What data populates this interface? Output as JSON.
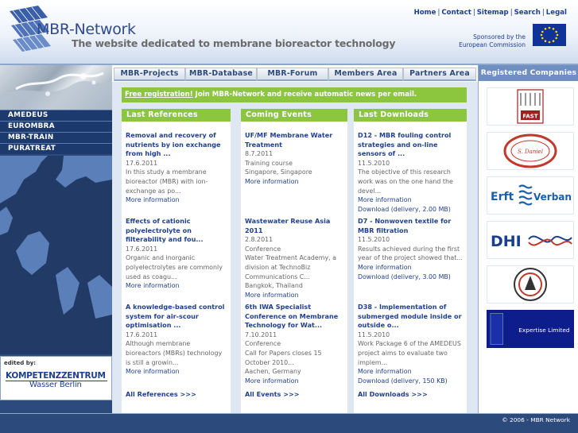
{
  "header": {
    "site_name": "MBR-Network",
    "tagline": "The website dedicated to membrane bioreactor technology",
    "top_links": [
      "Home",
      "Contact",
      "Sitemap",
      "Search",
      "Legal"
    ],
    "sponsor_line1": "Sponsored by the",
    "sponsor_line2": "European Commission"
  },
  "sidebar": {
    "projects": [
      "AMEDEUS",
      "EUROMBRA",
      "MBR-TRAIN",
      "PURATREAT"
    ],
    "edited_by": "edited by:",
    "editor_logo_line1": "KOMPETENZZENTRUM",
    "editor_logo_line2": "Wasser Berlin"
  },
  "tabs": [
    "MBR-Projects",
    "MBR-Database",
    "MBR-Forum",
    "Members Area",
    "Partners Area"
  ],
  "registration": {
    "link": "Free registration!",
    "text": " Join MBR-Network and receive automatic news per email."
  },
  "columns": [
    {
      "heading": "Last References",
      "entries": [
        {
          "title": "Removal and recovery of nutrients by ion exchange from high ...",
          "date": "17.6.2011",
          "desc": "In this study a membrane bioreactor (MBR) with ion-exchange as po...",
          "more": "More information"
        },
        {
          "title": "Effects of cationic polyelectrolyte on filterability and fou...",
          "date": "17.6.2011",
          "desc": "Organic and inorganic polyelectrolytes are commonly used as coagu...",
          "more": "More information"
        },
        {
          "title": "A knowledge-based control system for air-scour optimisation ...",
          "date": "17.6.2011",
          "desc": "Although membrane bioreactors (MBRs) technology is still a growin...",
          "more": "More information"
        }
      ],
      "all_link": "All References >>>"
    },
    {
      "heading": "Coming Events",
      "entries": [
        {
          "title": "UF/MF Membrane Water Treatment",
          "date": "8.7.2011",
          "desc": "Training course\nSingapore, Singapore",
          "more": "More information"
        },
        {
          "title": "Wastewater Reuse Asia 2011",
          "date": "2.8.2011",
          "desc": "Conference\nWater Treatment Academy, a division at TechnoBiz Communications C...\nBangkok, Thailand",
          "more": "More information"
        },
        {
          "title": "6th IWA Specialist Conference on Membrane Technology for Wat...",
          "date": "7.10.2011",
          "desc": "Conference\nCall for Papers closes 15 October 2010...\nAachen, Germany",
          "more": "More information"
        }
      ],
      "all_link": "All Events >>>"
    },
    {
      "heading": "Last Downloads",
      "entries": [
        {
          "title": "D12 - MBR fouling control strategies and on-line sensors of ...",
          "date": "11.5.2010",
          "desc": "The objective of this research work was on the one hand the devel...",
          "more": "More information",
          "download": "Download (delivery, 2.00 MB)"
        },
        {
          "title": "D7 - Nonwoven textile for MBR filtration",
          "date": "11.5.2010",
          "desc": "Results achieved during the first year of the project showed that...",
          "more": "More information",
          "download": "Download (delivery, 3.00 MB)"
        },
        {
          "title": "D38 - Implementation of submerged module inside or outside o...",
          "date": "11.5.2010",
          "desc": "Work Package 6 of the AMEDEUS project aims to evaluate two implem...",
          "more": "More information",
          "download": "Download (delivery, 150 KB)"
        }
      ],
      "all_link": "All Downloads >>>"
    }
  ],
  "registered": {
    "heading": "Registered Companies",
    "logo_texts": [
      "FAST",
      "S. Daniel",
      "Erft",
      "Verband",
      "DHI",
      "Expertise Limited"
    ]
  },
  "footer": {
    "copyright": "© 2006 - MBR Network"
  },
  "colors": {
    "navy": "#2d4a7d",
    "green": "#8cc63f",
    "link": "#1f3f8f",
    "panel": "#dfe7f2"
  }
}
